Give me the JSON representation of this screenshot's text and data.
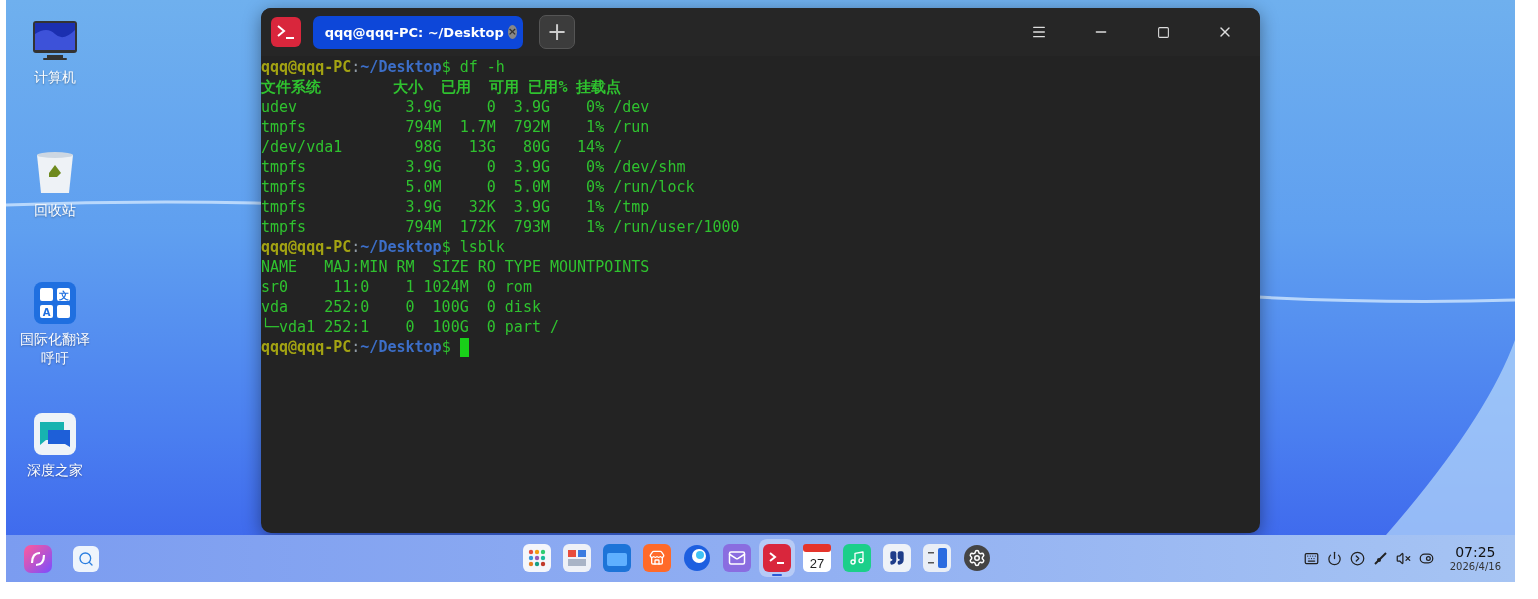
{
  "desktop_icons": [
    {
      "kind": "monitor",
      "label": "计算机"
    },
    {
      "kind": "trash",
      "label": "回收站"
    },
    {
      "kind": "translate",
      "label": "国际化翻译呼吁",
      "glyphs": [
        "文",
        "A"
      ]
    },
    {
      "kind": "chat",
      "label": "深度之家"
    }
  ],
  "terminal": {
    "tab": {
      "title": "qqq@qqq-PC: ~/Desktop",
      "close": "×",
      "selected": true
    },
    "new_tab": "+",
    "lines": [
      {
        "kind": "prompt",
        "user": "qqq@qqq-PC",
        "sep": ":",
        "path": "~/Desktop",
        "symbol": "$",
        "command": "df -h"
      },
      {
        "kind": "header",
        "text": "文件系统        大小  已用  可用 已用% 挂载点"
      },
      {
        "kind": "output",
        "text": "udev            3.9G     0  3.9G    0% /dev"
      },
      {
        "kind": "output",
        "text": "tmpfs           794M  1.7M  792M    1% /run"
      },
      {
        "kind": "output",
        "text": "/dev/vda1        98G   13G   80G   14% /"
      },
      {
        "kind": "output",
        "text": "tmpfs           3.9G     0  3.9G    0% /dev/shm"
      },
      {
        "kind": "output",
        "text": "tmpfs           5.0M     0  5.0M    0% /run/lock"
      },
      {
        "kind": "output",
        "text": "tmpfs           3.9G   32K  3.9G    1% /tmp"
      },
      {
        "kind": "output",
        "text": "tmpfs           794M  172K  793M    1% /run/user/1000"
      },
      {
        "kind": "prompt",
        "user": "qqq@qqq-PC",
        "sep": ":",
        "path": "~/Desktop",
        "symbol": "$",
        "command": "lsblk"
      },
      {
        "kind": "output",
        "text": "NAME   MAJ:MIN RM  SIZE RO TYPE MOUNTPOINTS"
      },
      {
        "kind": "output",
        "text": "sr0     11:0    1 1024M  0 rom"
      },
      {
        "kind": "output",
        "text": "vda    252:0    0  100G  0 disk"
      },
      {
        "kind": "output",
        "text": "└─vda1 252:1    0  100G  0 part /"
      },
      {
        "kind": "prompt",
        "user": "qqq@qqq-PC",
        "sep": ":",
        "path": "~/Desktop",
        "symbol": "$",
        "cursor": true
      }
    ]
  },
  "taskbar": {
    "left": [
      {
        "kind": "assistant"
      },
      {
        "kind": "search"
      }
    ],
    "dock": [
      {
        "kind": "launcher",
        "active": false
      },
      {
        "kind": "multitask",
        "active": false
      },
      {
        "kind": "files",
        "active": false
      },
      {
        "kind": "store",
        "active": false
      },
      {
        "kind": "browser",
        "active": false
      },
      {
        "kind": "mail",
        "active": false
      },
      {
        "kind": "terminal",
        "active": true
      },
      {
        "kind": "calendar",
        "active": false,
        "label": "27"
      },
      {
        "kind": "music",
        "active": false
      },
      {
        "kind": "notes",
        "active": false
      },
      {
        "kind": "calculator",
        "active": false
      },
      {
        "kind": "settings",
        "active": false
      }
    ],
    "tray": [
      {
        "kind": "keyboard"
      },
      {
        "kind": "power"
      },
      {
        "kind": "next"
      },
      {
        "kind": "pen"
      },
      {
        "kind": "mute"
      },
      {
        "kind": "toggle"
      }
    ],
    "time": "07:25",
    "date": "2026/4/16"
  }
}
